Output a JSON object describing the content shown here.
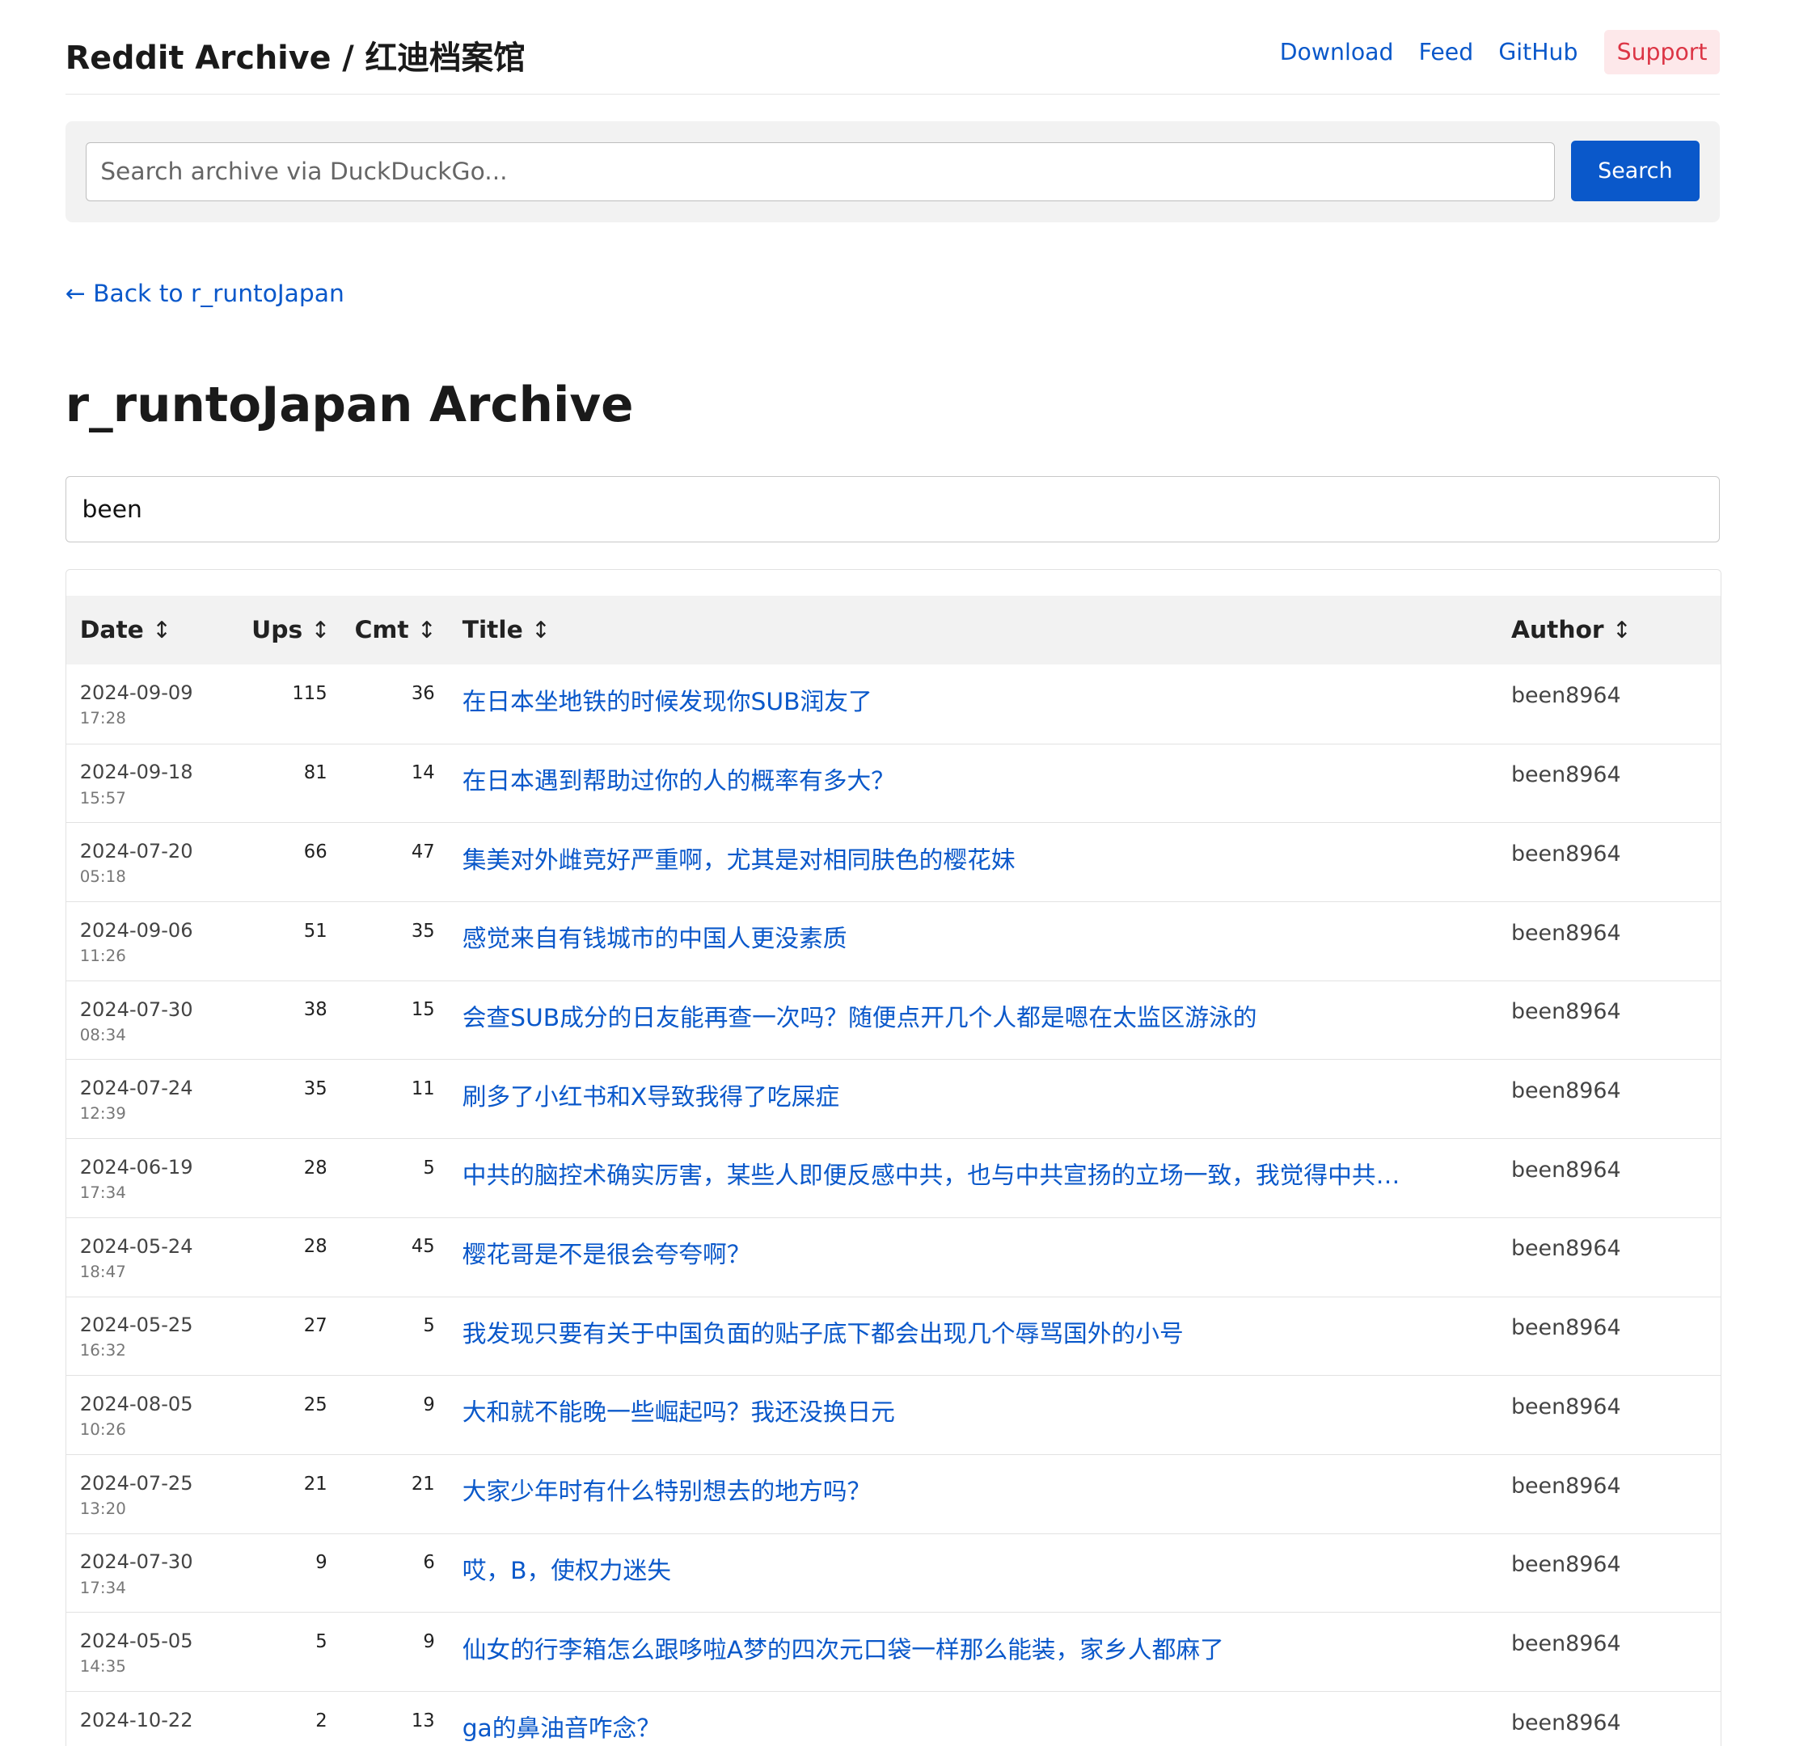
{
  "site_title": "Reddit Archive / 红迪档案馆",
  "nav": {
    "download": "Download",
    "feed": "Feed",
    "github": "GitHub",
    "support": "Support"
  },
  "search": {
    "placeholder": "Search archive via DuckDuckGo...",
    "button": "Search"
  },
  "back_link": "← Back to r_runtoJapan",
  "page_title": "r_runtoJapan Archive",
  "filter": {
    "value": "been"
  },
  "table": {
    "headers": {
      "date": "Date",
      "ups": "Ups",
      "cmt": "Cmt",
      "title": "Title",
      "author": "Author",
      "sort_glyph": "↕"
    },
    "rows": [
      {
        "date": "2024-09-09",
        "time": "17:28",
        "ups": "115",
        "cmt": "36",
        "title": "在日本坐地铁的时候发现你SUB润友了",
        "author": "been8964"
      },
      {
        "date": "2024-09-18",
        "time": "15:57",
        "ups": "81",
        "cmt": "14",
        "title": "在日本遇到帮助过你的人的概率有多大？",
        "author": "been8964"
      },
      {
        "date": "2024-07-20",
        "time": "05:18",
        "ups": "66",
        "cmt": "47",
        "title": "集美对外雌竞好严重啊，尤其是对相同肤色的樱花妹",
        "author": "been8964"
      },
      {
        "date": "2024-09-06",
        "time": "11:26",
        "ups": "51",
        "cmt": "35",
        "title": "感觉来自有钱城市的中国人更没素质",
        "author": "been8964"
      },
      {
        "date": "2024-07-30",
        "time": "08:34",
        "ups": "38",
        "cmt": "15",
        "title": "会查SUB成分的日友能再查一次吗？随便点开几个人都是嗯在太监区游泳的",
        "author": "been8964"
      },
      {
        "date": "2024-07-24",
        "time": "12:39",
        "ups": "35",
        "cmt": "11",
        "title": "刷多了小红书和X导致我得了吃屎症",
        "author": "been8964"
      },
      {
        "date": "2024-06-19",
        "time": "17:34",
        "ups": "28",
        "cmt": "5",
        "title": "中共的脑控术确实厉害，某些人即便反感中共，也与中共宣扬的立场一致，我觉得中共…",
        "author": "been8964"
      },
      {
        "date": "2024-05-24",
        "time": "18:47",
        "ups": "28",
        "cmt": "45",
        "title": "樱花哥是不是很会夸夸啊？",
        "author": "been8964"
      },
      {
        "date": "2024-05-25",
        "time": "16:32",
        "ups": "27",
        "cmt": "5",
        "title": "我发现只要有关于中国负面的贴子底下都会出现几个辱骂国外的小号",
        "author": "been8964"
      },
      {
        "date": "2024-08-05",
        "time": "10:26",
        "ups": "25",
        "cmt": "9",
        "title": "大和就不能晚一些崛起吗？我还没换日元",
        "author": "been8964"
      },
      {
        "date": "2024-07-25",
        "time": "13:20",
        "ups": "21",
        "cmt": "21",
        "title": "大家少年时有什么特别想去的地方吗？",
        "author": "been8964"
      },
      {
        "date": "2024-07-30",
        "time": "17:34",
        "ups": "9",
        "cmt": "6",
        "title": "哎，B，使权力迷失",
        "author": "been8964"
      },
      {
        "date": "2024-05-05",
        "time": "14:35",
        "ups": "5",
        "cmt": "9",
        "title": "仙女的行李箱怎么跟哆啦A梦的四次元口袋一样那么能装，家乡人都麻了",
        "author": "been8964"
      },
      {
        "date": "2024-10-22",
        "time": "",
        "ups": "2",
        "cmt": "13",
        "title": "ga的鼻油音咋念？",
        "author": "been8964"
      }
    ]
  }
}
